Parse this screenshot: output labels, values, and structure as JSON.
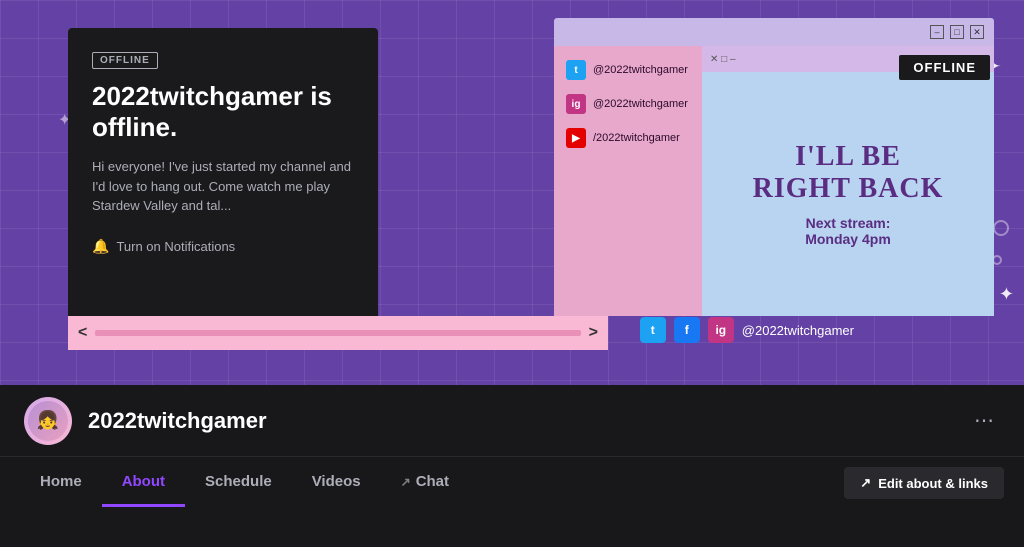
{
  "hero": {
    "offline_badge": "OFFLINE",
    "offline_title": "2022twitchgamer is offline.",
    "offline_desc": "Hi everyone! I've just started my channel and I'd love to hang out. Come watch me play Stardew Valley and tal...",
    "notif_label": "Turn on Notifications",
    "offline_top_right": "OFFLINE"
  },
  "links_sidebar": {
    "twitter": "@2022twitchgamer",
    "instagram": "@2022twitchgamer",
    "youtube": "/2022twitchgamer"
  },
  "back_card": {
    "line1": "I'LL BE",
    "line2": "RIGHT BACK",
    "subtitle1": "Next stream:",
    "subtitle2": "Monday 4pm"
  },
  "social_bar": {
    "handle": "@2022twitchgamer"
  },
  "channel": {
    "name": "2022twitchgamer"
  },
  "nav": {
    "tabs": [
      {
        "label": "Home",
        "active": false
      },
      {
        "label": "About",
        "active": true
      },
      {
        "label": "Schedule",
        "active": false
      },
      {
        "label": "Videos",
        "active": false
      },
      {
        "label": "Chat",
        "active": false,
        "external": true
      }
    ],
    "edit_btn": "Edit about & links",
    "chat_external_icon": "↗"
  }
}
